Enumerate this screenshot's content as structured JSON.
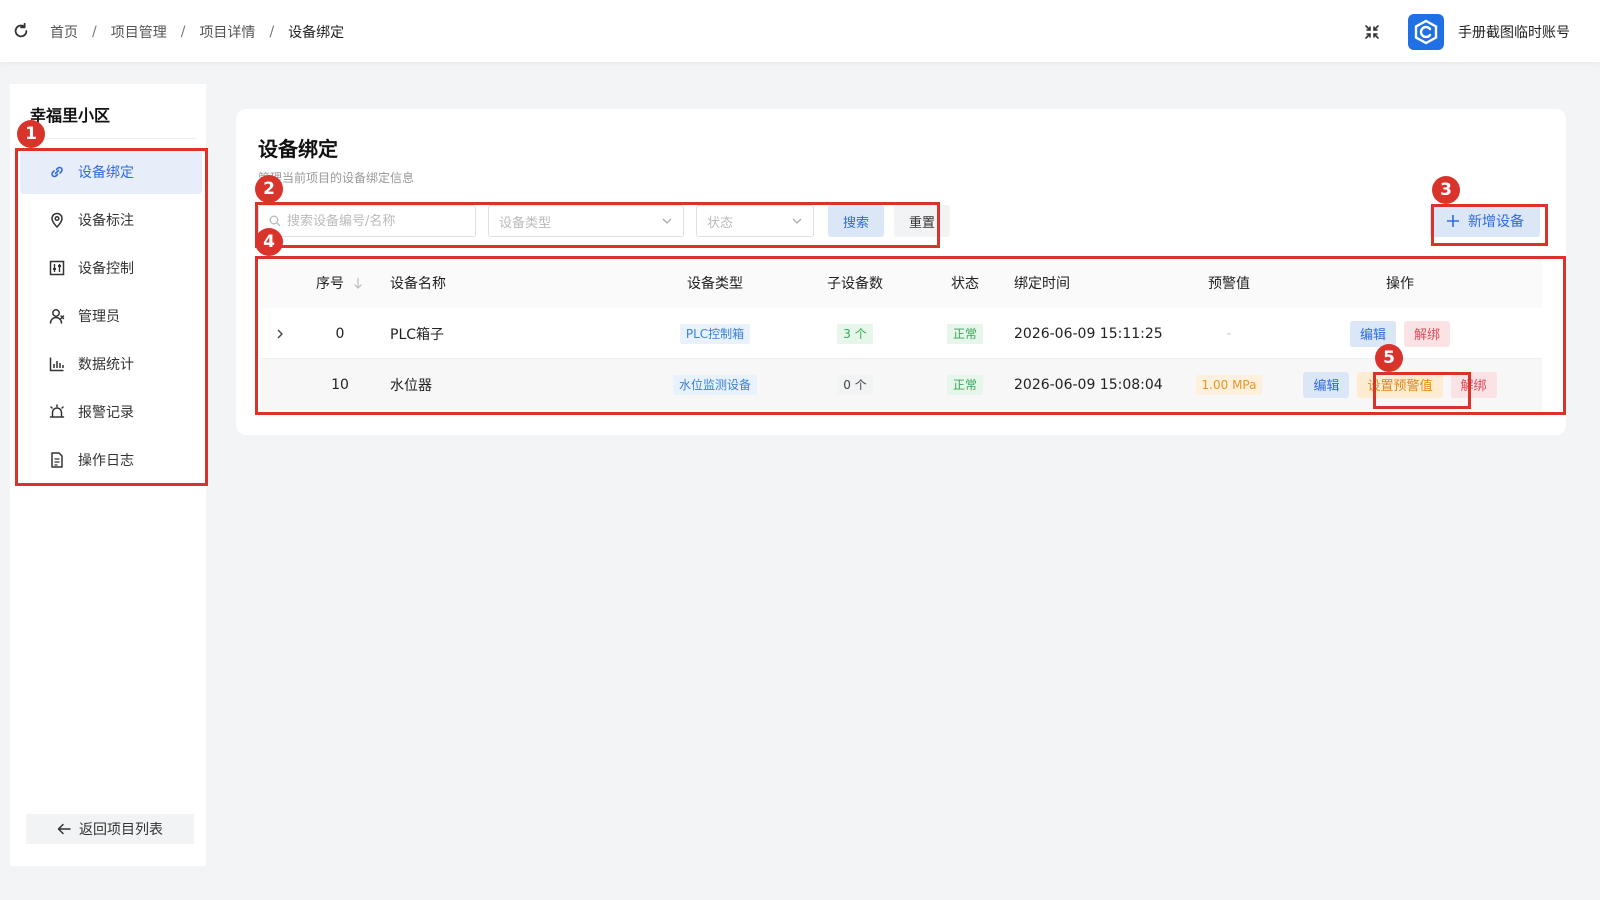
{
  "breadcrumb": [
    "首页",
    "项目管理",
    "项目详情",
    "设备绑定"
  ],
  "account": "手册截图临时账号",
  "sidebar": {
    "project_name": "幸福里小区",
    "items": [
      {
        "label": "设备绑定",
        "icon": "link-icon",
        "active": true
      },
      {
        "label": "设备标注",
        "icon": "location-pin-icon"
      },
      {
        "label": "设备控制",
        "icon": "sliders-icon"
      },
      {
        "label": "管理员",
        "icon": "user-icon"
      },
      {
        "label": "数据统计",
        "icon": "bar-chart-icon"
      },
      {
        "label": "报警记录",
        "icon": "alarm-icon"
      },
      {
        "label": "操作日志",
        "icon": "document-icon"
      }
    ],
    "back_label": "返回项目列表"
  },
  "main": {
    "title": "设备绑定",
    "subtitle": "管理当前项目的设备绑定信息",
    "search_placeholder": "搜索设备编号/名称",
    "type_placeholder": "设备类型",
    "status_placeholder": "状态",
    "search_label": "搜索",
    "reset_label": "重置",
    "add_label": "新增设备"
  },
  "table": {
    "columns": [
      "序号",
      "设备名称",
      "设备类型",
      "子设备数",
      "状态",
      "绑定时间",
      "预警值",
      "操作"
    ],
    "rows": [
      {
        "index": "0",
        "name": "PLC箱子",
        "type": "PLC控制箱",
        "children": "3 个",
        "status": "正常",
        "time": "2026-06-09 15:11:25",
        "warn": "-",
        "actions": [
          "编辑",
          "解绑"
        ]
      },
      {
        "index": "10",
        "name": "水位器",
        "type": "水位监测设备",
        "children": "0 个",
        "status": "正常",
        "time": "2026-06-09 15:08:04",
        "warn": "1.00 MPa",
        "actions": [
          "编辑",
          "设置预警值",
          "解绑"
        ]
      }
    ]
  },
  "annotations": [
    "1",
    "2",
    "3",
    "4",
    "5"
  ],
  "colors": {
    "primary": "#2f6bdc",
    "annotation": "#d9342b",
    "success": "#3aa658",
    "danger": "#e04a5a",
    "warning": "#e28a1c"
  }
}
